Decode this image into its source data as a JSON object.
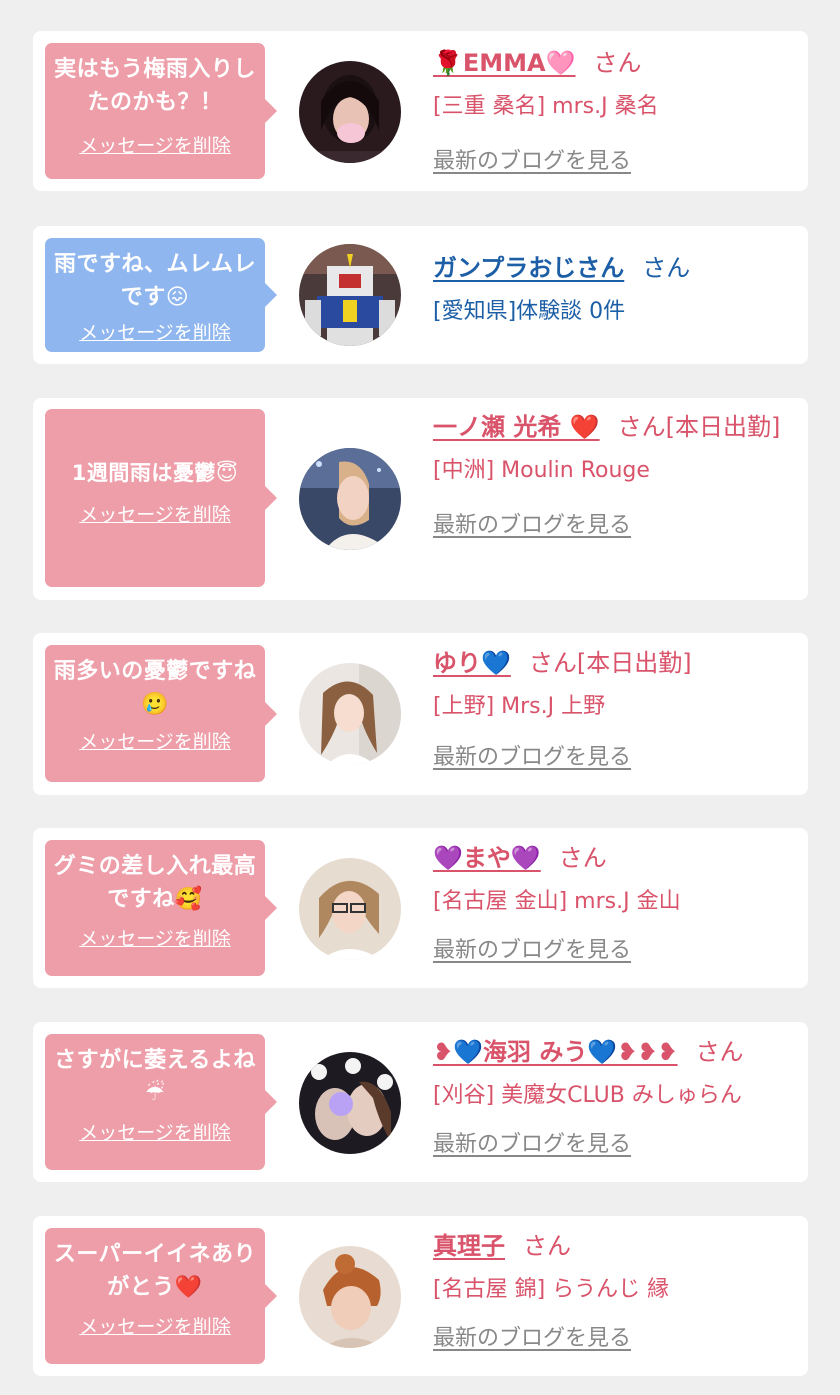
{
  "colors": {
    "pink_bubble": "#ee9ea8",
    "blue_bubble": "#8fb6ee",
    "pink_text": "#d9536a",
    "blue_text": "#1d5fa6",
    "link_gray": "#888888",
    "background": "#efefef"
  },
  "messages": [
    {
      "bubble_text": "実はもう梅雨入りしたのかも？！",
      "delete_label": "メッセージを削除",
      "name": "🌹EMMA🩷",
      "honorific": "さん",
      "shop": "[三重 桑名] mrs.J 桑名",
      "blog_label": "最新のブログを見る",
      "theme": "pink",
      "avatar_icon": "woman-photo-icon"
    },
    {
      "bubble_text": "雨ですね、ムレムレです😖",
      "delete_label": "メッセージを削除",
      "name": "ガンプラおじさん",
      "honorific": "さん",
      "shop": "[愛知県]体験談 0件",
      "blog_label": "",
      "theme": "blue",
      "avatar_icon": "robot-model-icon"
    },
    {
      "bubble_text": "1週間雨は憂鬱😇",
      "delete_label": "メッセージを削除",
      "name": "一ノ瀬 光希 ❤️",
      "honorific": "さん[本日出勤]",
      "shop": "[中洲] Moulin Rouge",
      "blog_label": "最新のブログを見る",
      "theme": "pink",
      "avatar_icon": "woman-photo-icon"
    },
    {
      "bubble_text": "雨多いの憂鬱ですね🥲",
      "delete_label": "メッセージを削除",
      "name": "ゆり💙",
      "honorific": "さん[本日出勤]",
      "shop": "[上野] Mrs.J 上野",
      "blog_label": "最新のブログを見る",
      "theme": "pink",
      "avatar_icon": "woman-photo-icon"
    },
    {
      "bubble_text": "グミの差し入れ最高ですね🥰",
      "delete_label": "メッセージを削除",
      "name": "💜まや💜",
      "honorific": "さん",
      "shop": "[名古屋 金山] mrs.J 金山",
      "blog_label": "最新のブログを見る",
      "theme": "pink",
      "avatar_icon": "woman-photo-icon"
    },
    {
      "bubble_text": "さすがに萎えるよね☔",
      "delete_label": "メッセージを削除",
      "name": "❥💙海羽 みう💙❥❥❥",
      "honorific": "さん",
      "shop": "[刈谷] 美魔女CLUB みしゅらん",
      "blog_label": "最新のブログを見る",
      "theme": "pink",
      "avatar_icon": "woman-photo-icon"
    },
    {
      "bubble_text": "スーパーイイネありがとう❤️",
      "delete_label": "メッセージを削除",
      "name": "真理子",
      "honorific": "さん",
      "shop": "[名古屋 錦] らうんじ 縁",
      "blog_label": "最新のブログを見る",
      "theme": "pink",
      "avatar_icon": "woman-photo-icon"
    }
  ]
}
